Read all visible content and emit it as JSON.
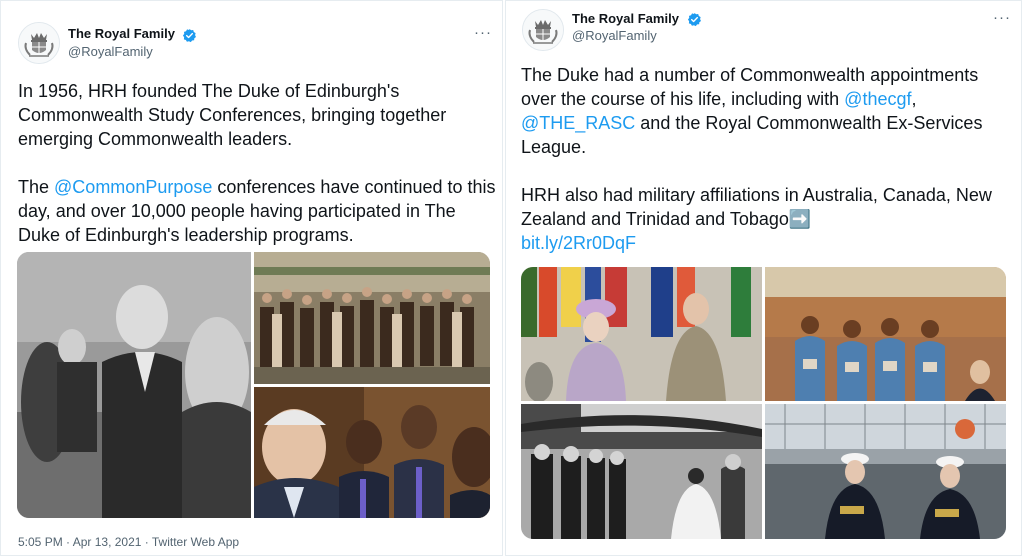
{
  "left_tweet": {
    "display_name": "The Royal Family",
    "handle": "@RoyalFamily",
    "more_label": "···",
    "text": {
      "p1": "In 1956, HRH founded The Duke of Edinburgh's Commonwealth Study Conferences, bringing together emerging Commonwealth leaders.",
      "p2_pre": "The ",
      "p2_link": "@CommonPurpose",
      "p2_post": " conferences have continued to this day, and over 10,000 people having participated in The Duke of Edinburgh's leadership programs."
    },
    "meta": {
      "time": "5:05 PM",
      "sep1": " · ",
      "date": "Apr 13, 2021",
      "sep2": " · ",
      "client": "Twitter Web App"
    }
  },
  "right_tweet": {
    "display_name": "The Royal Family",
    "handle": "@RoyalFamily",
    "more_label": "···",
    "text": {
      "p1_pre": "The Duke had a number of Commonwealth appointments over the course of his life, including with ",
      "p1_link1": "@thecgf",
      "p1_mid": ", ",
      "p1_link2": "@THE_RASC",
      "p1_post": " and the Royal Commonwealth Ex-Services League.",
      "p2_pre": "HRH also had military affiliations in Australia, Canada, New Zealand and Trinidad and Tobago",
      "p2_emoji": "➡️",
      "p2_link": "bit.ly/2Rr0DqF"
    }
  },
  "colors": {
    "link": "#1d9bf0",
    "verified": "#1d9bf0",
    "secondary_text": "#536471",
    "border": "#e6ecf0"
  },
  "icons": [
    "royal-crest-icon",
    "verified-badge-icon",
    "more-options-icon"
  ]
}
